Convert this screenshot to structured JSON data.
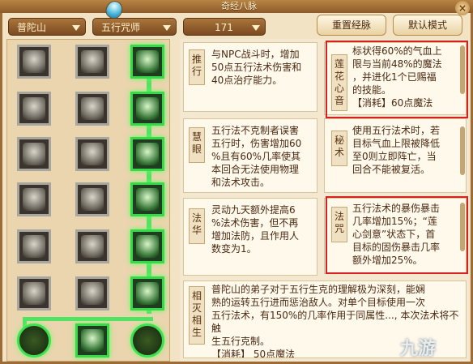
{
  "title": "奇经八脉",
  "close": "×",
  "dropdowns": {
    "school": "普陀山",
    "sect": "五行咒师",
    "level": "171"
  },
  "buttons": {
    "reset": "重置经脉",
    "default": "默认模式"
  },
  "nodes": {
    "col1": [
      "lotus-icon",
      "spikes-icon",
      "shards-icon",
      "figure-icon",
      "bamboo-icon",
      "leaf-icon",
      "pagoda-icon"
    ],
    "col2": [
      "grass-icon",
      "hand-icon",
      "monk-icon",
      "sword-icon",
      "lily-icon",
      "tower-icon",
      "bagua-icon"
    ],
    "col3": [
      "cube-icon",
      "flame-icon",
      "beast-icon",
      "vase-icon",
      "swirl-icon",
      "pentagram-icon",
      "circle-icon"
    ]
  },
  "cards": [
    {
      "tab": "推\n行",
      "text": "与NPC战斗时，增加\n50点五行法术伤害和\n40点治疗能力。"
    },
    {
      "tab": "慧\n眼",
      "text": "五行法不克制者误害\n五行时，伤害增加60\n%且有60%几率使其\n本回合无法使用物理\n和法术攻击。"
    },
    {
      "tab": "法\n华",
      "text": "灵动九天额外提高6\n%法术伤害，但不再\n增加法防，且作用人\n数变为1。"
    },
    {
      "tab": "相\n灭\n相\n生",
      "text": "普陀山的弟子对于五行生克的理解极为深刻，能娴\n熟的运转五行进而惩治敌人。对单个目标使用一次\n五行法术，有150%的几率作用于同属性..., 本次法术将不触\n生五行克制。\n【消耗】 50点魔法"
    },
    {
      "tab": "莲\n花\n心\n音",
      "text": "标状得60%的气血上\n限与当前48%的魔法\n，并进化1个已赐福\n的技能。\n【消耗】60点魔法"
    },
    {
      "tab": "秘\n术",
      "text": "使用五行法术时，若\n目标气血上限被降低\n至0则立即阵亡，当\n回合不能被复活。"
    },
    {
      "tab": "法\n咒",
      "text": "五行法术的暴伤暴击\n几率增加15%；“莲\n心剑意”状态下，首\n目标的固伤暴击几率\n额外增加25%。"
    }
  ],
  "watermark": "九游"
}
